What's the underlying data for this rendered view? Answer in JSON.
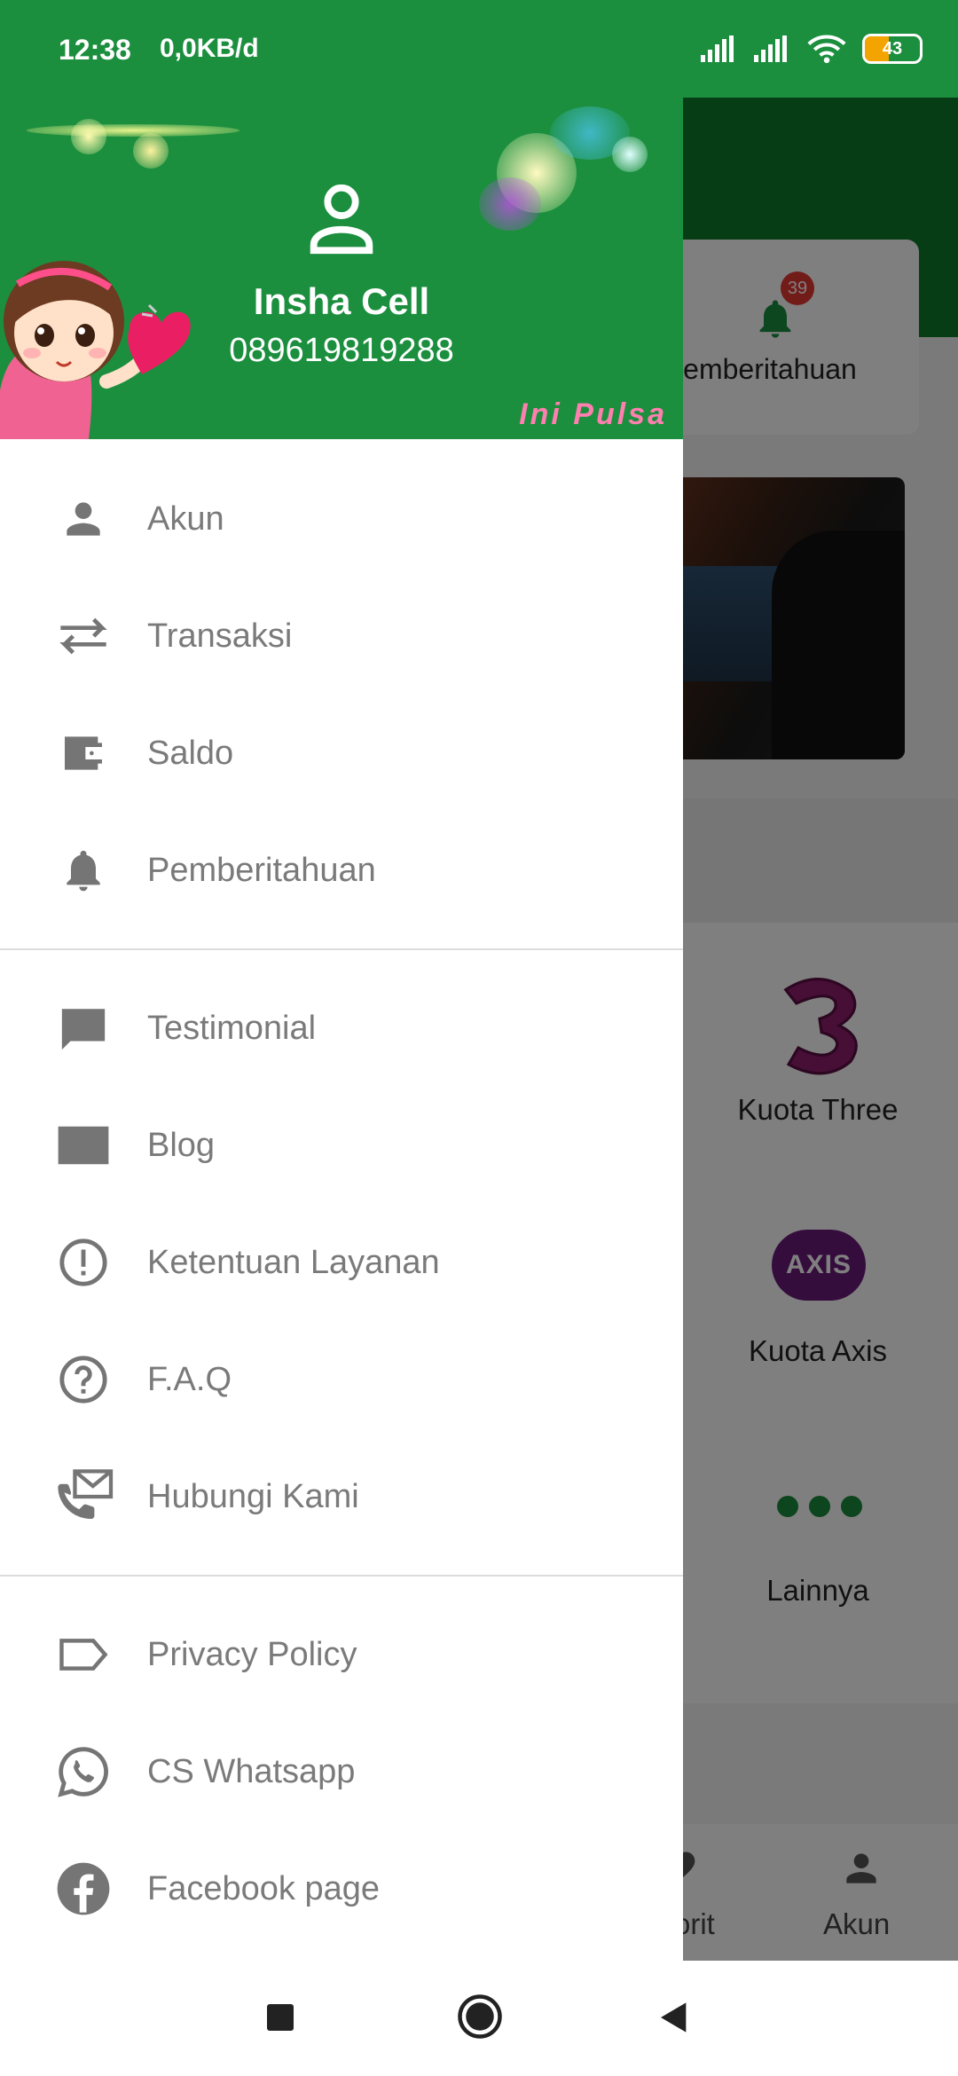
{
  "status_bar": {
    "time": "12:38",
    "network_speed": "0,0KB/d",
    "battery": "43",
    "battery_level": 0.43
  },
  "drawer": {
    "profile": {
      "name": "Insha Cell",
      "phone": "089619819288",
      "brand": "Ini Pulsa"
    },
    "sections": [
      {
        "items": [
          {
            "label": "Akun",
            "icon": "person-icon"
          },
          {
            "label": "Transaksi",
            "icon": "swap-arrows-icon"
          },
          {
            "label": "Saldo",
            "icon": "wallet-icon"
          },
          {
            "label": "Pemberitahuan",
            "icon": "bell-icon"
          }
        ]
      },
      {
        "items": [
          {
            "label": "Testimonial",
            "icon": "comment-icon"
          },
          {
            "label": "Blog",
            "icon": "article-icon"
          },
          {
            "label": "Ketentuan Layanan",
            "icon": "alert-circle-icon"
          },
          {
            "label": "F.A.Q",
            "icon": "help-circle-icon"
          },
          {
            "label": "Hubungi Kami",
            "icon": "contact-mail-phone-icon"
          }
        ]
      },
      {
        "items": [
          {
            "label": "Privacy Policy",
            "icon": "label-tag-icon"
          },
          {
            "label": "CS Whatsapp",
            "icon": "whatsapp-icon"
          },
          {
            "label": "Facebook page",
            "icon": "facebook-icon"
          }
        ]
      }
    ]
  },
  "background": {
    "notification_label": "emberitahuan",
    "notification_badge": "39",
    "products": [
      {
        "label": "Kuota Three",
        "icon": "three-logo-icon"
      },
      {
        "label": "Kuota Axis",
        "icon": "axis-logo-icon"
      },
      {
        "label": "Lainnya",
        "icon": "more-dots-icon"
      }
    ],
    "axis_logo_text": "AXIS",
    "nav": [
      {
        "label": "orit",
        "icon": "heart-icon"
      },
      {
        "label": "Akun",
        "icon": "person-icon"
      }
    ]
  },
  "colors": {
    "primary_green": "#1b8f3e",
    "dark_green": "#0f7a2b",
    "menu_text": "#7a7a7a",
    "badge_red": "#e53935",
    "brand_pink": "#ff7fb0"
  }
}
